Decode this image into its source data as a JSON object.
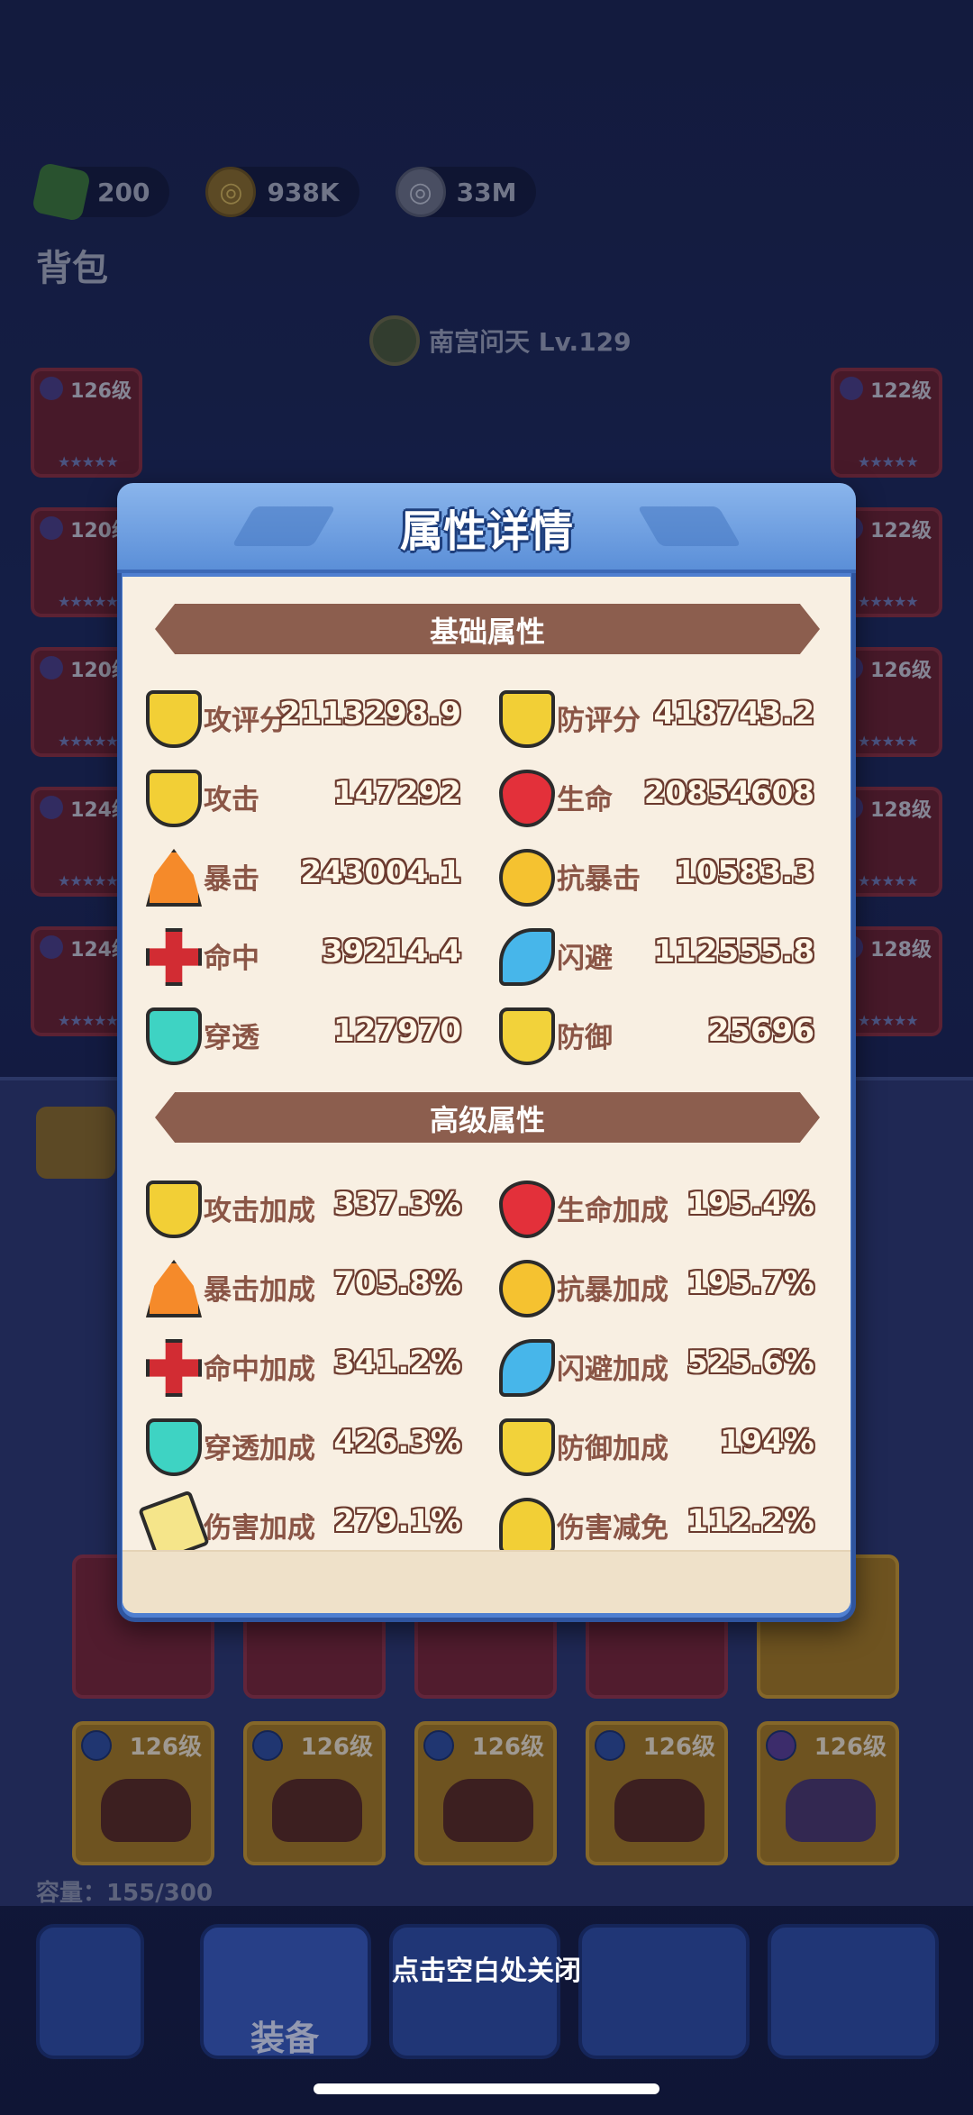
{
  "currency": {
    "gems": "200",
    "gold": "938K",
    "silver": "33M"
  },
  "page_title": "背包",
  "character": {
    "name": "南宫问天 Lv.129"
  },
  "equipped_left": [
    {
      "level": "126级",
      "stars": "★★★★★",
      "star_count": "5"
    },
    {
      "level": "120级",
      "stars": "★★★★★",
      "star_count": "5"
    },
    {
      "level": "120级",
      "stars": "★★★★★",
      "star_count": "5"
    },
    {
      "level": "124级",
      "stars": "★★★★★",
      "star_count": "5"
    },
    {
      "level": "124级",
      "stars": "★★★★★",
      "star_count": "5"
    }
  ],
  "equipped_right": [
    {
      "level": "122级",
      "stars": "★★★★★",
      "star_count": "5"
    },
    {
      "level": "122级",
      "stars": "★★★★★",
      "star_count": "5"
    },
    {
      "level": "126级",
      "stars": "★★★★★",
      "star_count": "5"
    },
    {
      "level": "128级",
      "stars": "★★★★★",
      "star_count": "5"
    },
    {
      "level": "128级",
      "stars": "★★★★★",
      "star_count": "5"
    }
  ],
  "bag_items_bottom_row": [
    {
      "level": "126级"
    },
    {
      "level": "126级"
    },
    {
      "level": "126级"
    },
    {
      "level": "126级"
    },
    {
      "level": "126级"
    }
  ],
  "capacity": "容量：155/300",
  "nav": {
    "active_label": "装备"
  },
  "close_hint": "点击空白处关闭",
  "modal": {
    "title": "属性详情",
    "basic": {
      "heading": "基础属性",
      "stats": [
        {
          "name": "攻评分",
          "value": "2113298.9",
          "icon": "attack-rating-icon"
        },
        {
          "name": "防评分",
          "value": "418743.2",
          "icon": "defense-rating-icon"
        },
        {
          "name": "攻击",
          "value": "147292",
          "icon": "attack-icon"
        },
        {
          "name": "生命",
          "value": "20854608",
          "icon": "heart-icon"
        },
        {
          "name": "暴击",
          "value": "243004.1",
          "icon": "crit-fire-icon"
        },
        {
          "name": "抗暴击",
          "value": "10583.3",
          "icon": "crit-resist-icon"
        },
        {
          "name": "命中",
          "value": "39214.4",
          "icon": "hit-cross-icon"
        },
        {
          "name": "闪避",
          "value": "112555.8",
          "icon": "dodge-wing-icon"
        },
        {
          "name": "穿透",
          "value": "127970",
          "icon": "penetration-icon"
        },
        {
          "name": "防御",
          "value": "25696",
          "icon": "defense-shield-icon"
        }
      ]
    },
    "advanced": {
      "heading": "高级属性",
      "stats": [
        {
          "name": "攻击加成",
          "value": "337.3%",
          "icon": "attack-bonus-icon"
        },
        {
          "name": "生命加成",
          "value": "195.4%",
          "icon": "hp-bonus-heart-icon"
        },
        {
          "name": "暴击加成",
          "value": "705.8%",
          "icon": "crit-bonus-icon"
        },
        {
          "name": "抗暴加成",
          "value": "195.7%",
          "icon": "crit-resist-bonus-icon"
        },
        {
          "name": "命中加成",
          "value": "341.2%",
          "icon": "hit-bonus-icon"
        },
        {
          "name": "闪避加成",
          "value": "525.6%",
          "icon": "dodge-bonus-icon"
        },
        {
          "name": "穿透加成",
          "value": "426.3%",
          "icon": "penetration-bonus-icon"
        },
        {
          "name": "防御加成",
          "value": "194%",
          "icon": "defense-bonus-icon"
        },
        {
          "name": "伤害加成",
          "value": "279.1%",
          "icon": "damage-bonus-icon"
        },
        {
          "name": "伤害减免",
          "value": "112.2%",
          "icon": "damage-reduction-icon"
        }
      ]
    }
  }
}
